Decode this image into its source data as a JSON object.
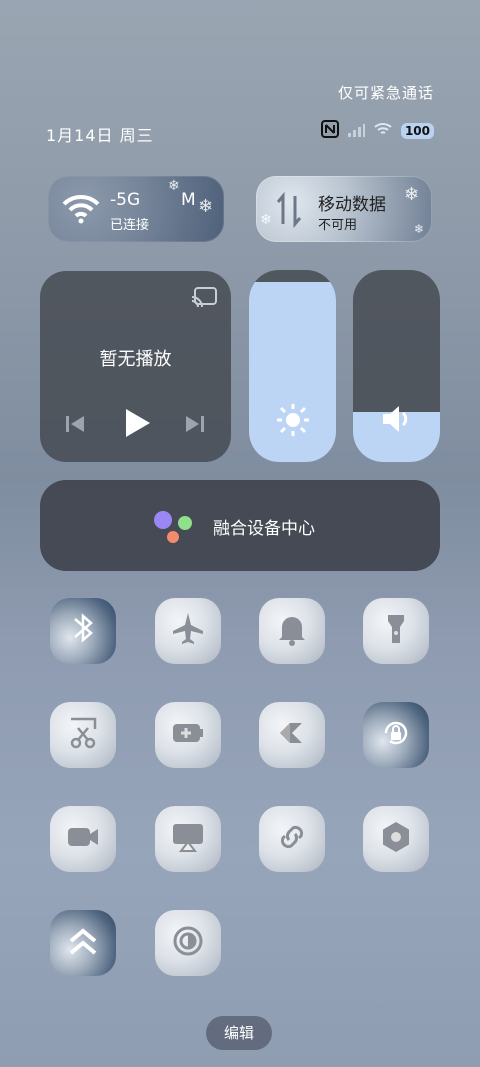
{
  "status": {
    "emergency_text": "仅可紧急通话",
    "date": "1月14日 周三",
    "battery": "100"
  },
  "wifi_tile": {
    "title": "-5G",
    "extra": "M",
    "subtitle": "已连接"
  },
  "data_tile": {
    "title": "移动数据",
    "subtitle": "不可用"
  },
  "media": {
    "label": "暂无播放"
  },
  "brightness": {
    "level_percent": 94
  },
  "volume": {
    "level_percent": 26
  },
  "fusion": {
    "label": "融合设备中心"
  },
  "tiles": [
    {
      "icon": "bluetooth-icon",
      "active": true
    },
    {
      "icon": "airplane-icon",
      "active": false
    },
    {
      "icon": "bell-icon",
      "active": false
    },
    {
      "icon": "flashlight-icon",
      "active": false
    },
    {
      "icon": "scissors-icon",
      "active": false
    },
    {
      "icon": "battery-saver-icon",
      "active": false
    },
    {
      "icon": "share-arrow-icon",
      "active": false
    },
    {
      "icon": "rotation-lock-icon",
      "active": true
    },
    {
      "icon": "video-camera-icon",
      "active": false
    },
    {
      "icon": "screen-cast-icon",
      "active": false
    },
    {
      "icon": "link-icon",
      "active": false
    },
    {
      "icon": "nfc-hex-icon",
      "active": false
    },
    {
      "icon": "double-chevron-up-icon",
      "active": true
    },
    {
      "icon": "contrast-icon",
      "active": false
    }
  ],
  "edit_label": "编辑",
  "colors": {
    "accent": "#bcd5f4",
    "panel": "#464b52"
  }
}
